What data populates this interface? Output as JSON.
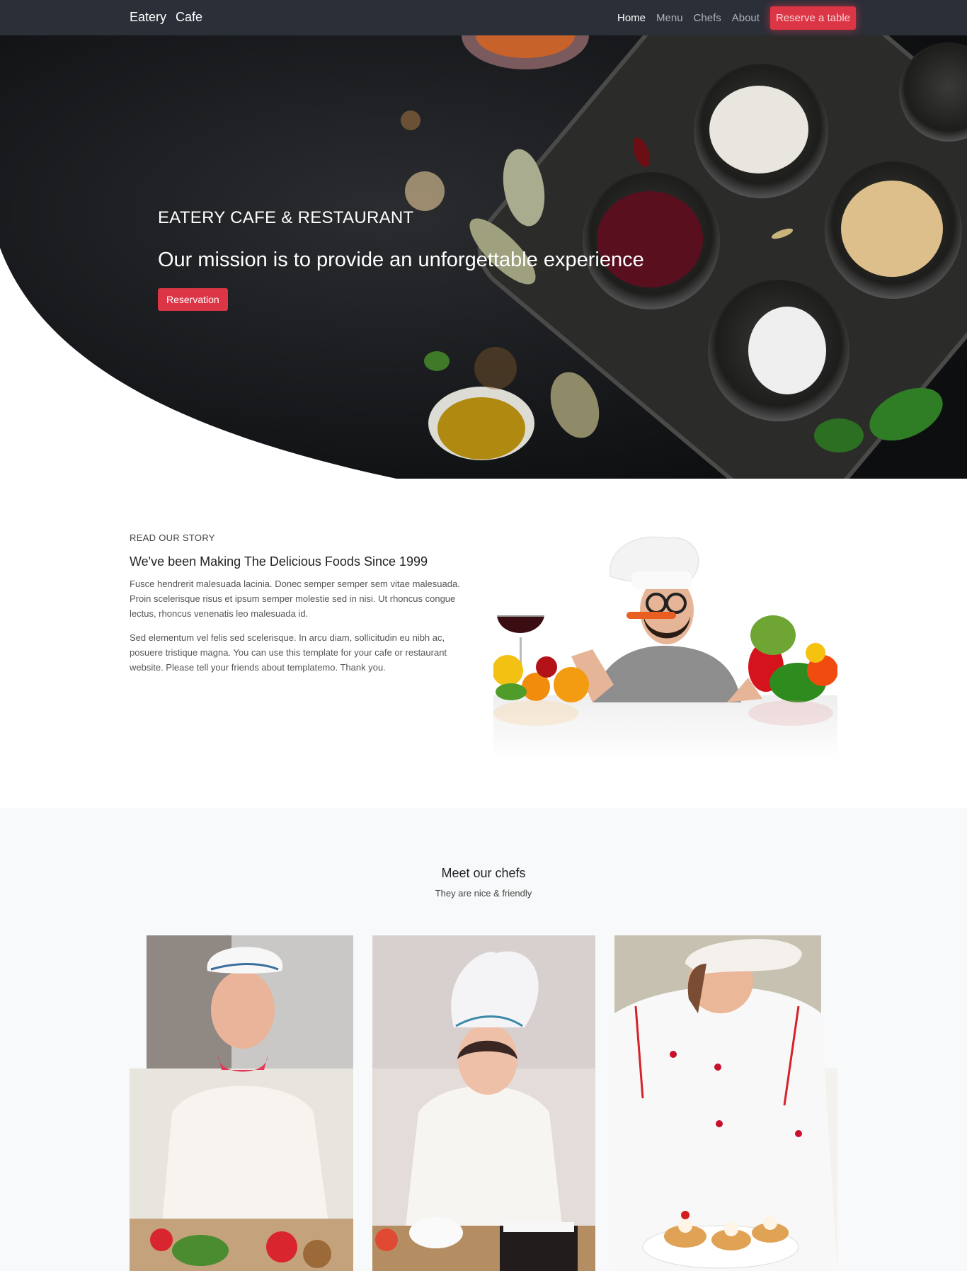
{
  "navbar": {
    "brand_part1": "Eatery",
    "brand_part2": "Cafe",
    "links": [
      "Home",
      "Menu",
      "Chefs",
      "About"
    ],
    "cta": "Reserve a table"
  },
  "hero": {
    "subtitle": "EATERY CAFE & RESTAURANT",
    "title": "Our mission is to provide an unforgettable experience",
    "button": "Reservation"
  },
  "story": {
    "kicker": "READ OUR STORY",
    "title": "We've been Making The Delicious Foods Since 1999",
    "paragraph1": "Fusce hendrerit malesuada lacinia. Donec semper semper sem vitae malesuada. Proin scelerisque risus et ipsum semper molestie sed in nisi. Ut rhoncus congue lectus, rhoncus venenatis leo malesuada id.",
    "paragraph2": "Sed elementum vel felis sed scelerisque. In arcu diam, sollicitudin eu nibh ac, posuere tristique magna. You can use this template for your cafe or restaurant website. Please tell your friends about templatemo. Thank you."
  },
  "chefs": {
    "title": "Meet our chefs",
    "subtitle": "They are nice & friendly"
  },
  "colors": {
    "navbar_bg": "#2b2f38",
    "accent": "#dc3545",
    "section_bg": "#f8f9fa"
  }
}
